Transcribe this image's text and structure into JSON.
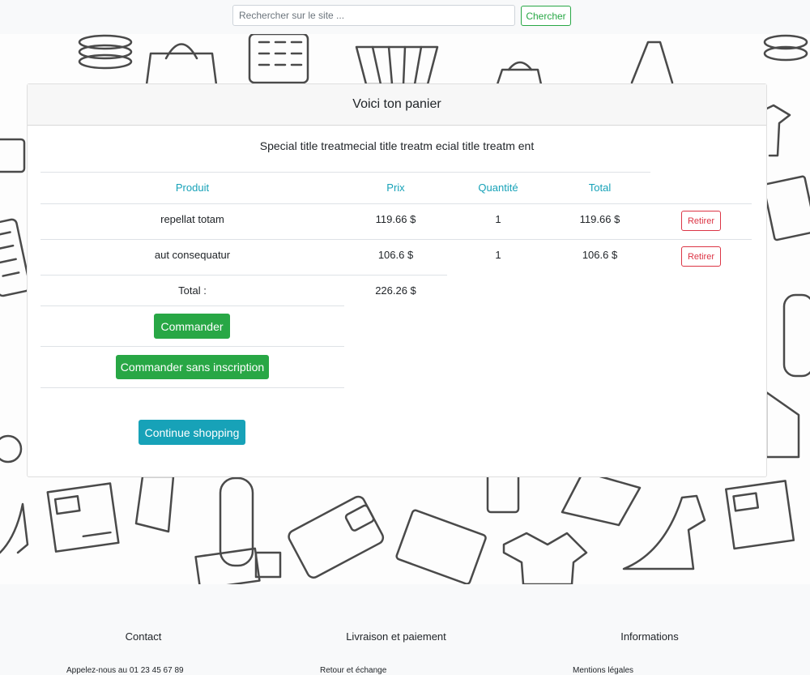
{
  "search": {
    "placeholder": "Rechercher sur le site ...",
    "button_label": "Chercher"
  },
  "cart": {
    "header_title": "Voici ton panier",
    "card_title": "Special title treatmecial title treatm ecial title treatm ent",
    "columns": [
      "Produit",
      "Prix",
      "Quantité",
      "Total"
    ],
    "rows": [
      {
        "product": "repellat totam",
        "price": "119.66 $",
        "quantity": "1",
        "total": "119.66 $",
        "remove_label": "Retirer"
      },
      {
        "product": "aut consequatur",
        "price": "106.6 $",
        "quantity": "1",
        "total": "106.6 $",
        "remove_label": "Retirer"
      }
    ],
    "total_label": "Total :",
    "total_value": "226.26 $",
    "order_button": "Commander",
    "order_guest_button": "Commander sans inscription",
    "continue_button": "Continue shopping"
  },
  "footer": {
    "columns": [
      {
        "title": "Contact",
        "line": "Appelez-nous au 01 23 45 67 89"
      },
      {
        "title": "Livraison et paiement",
        "line": "Retour et échange"
      },
      {
        "title": "Informations",
        "line": "Mentions légales"
      }
    ]
  },
  "colors": {
    "primary_text": "#212529",
    "info": "#17a2b8",
    "success": "#28a745",
    "danger": "#dc3545"
  }
}
